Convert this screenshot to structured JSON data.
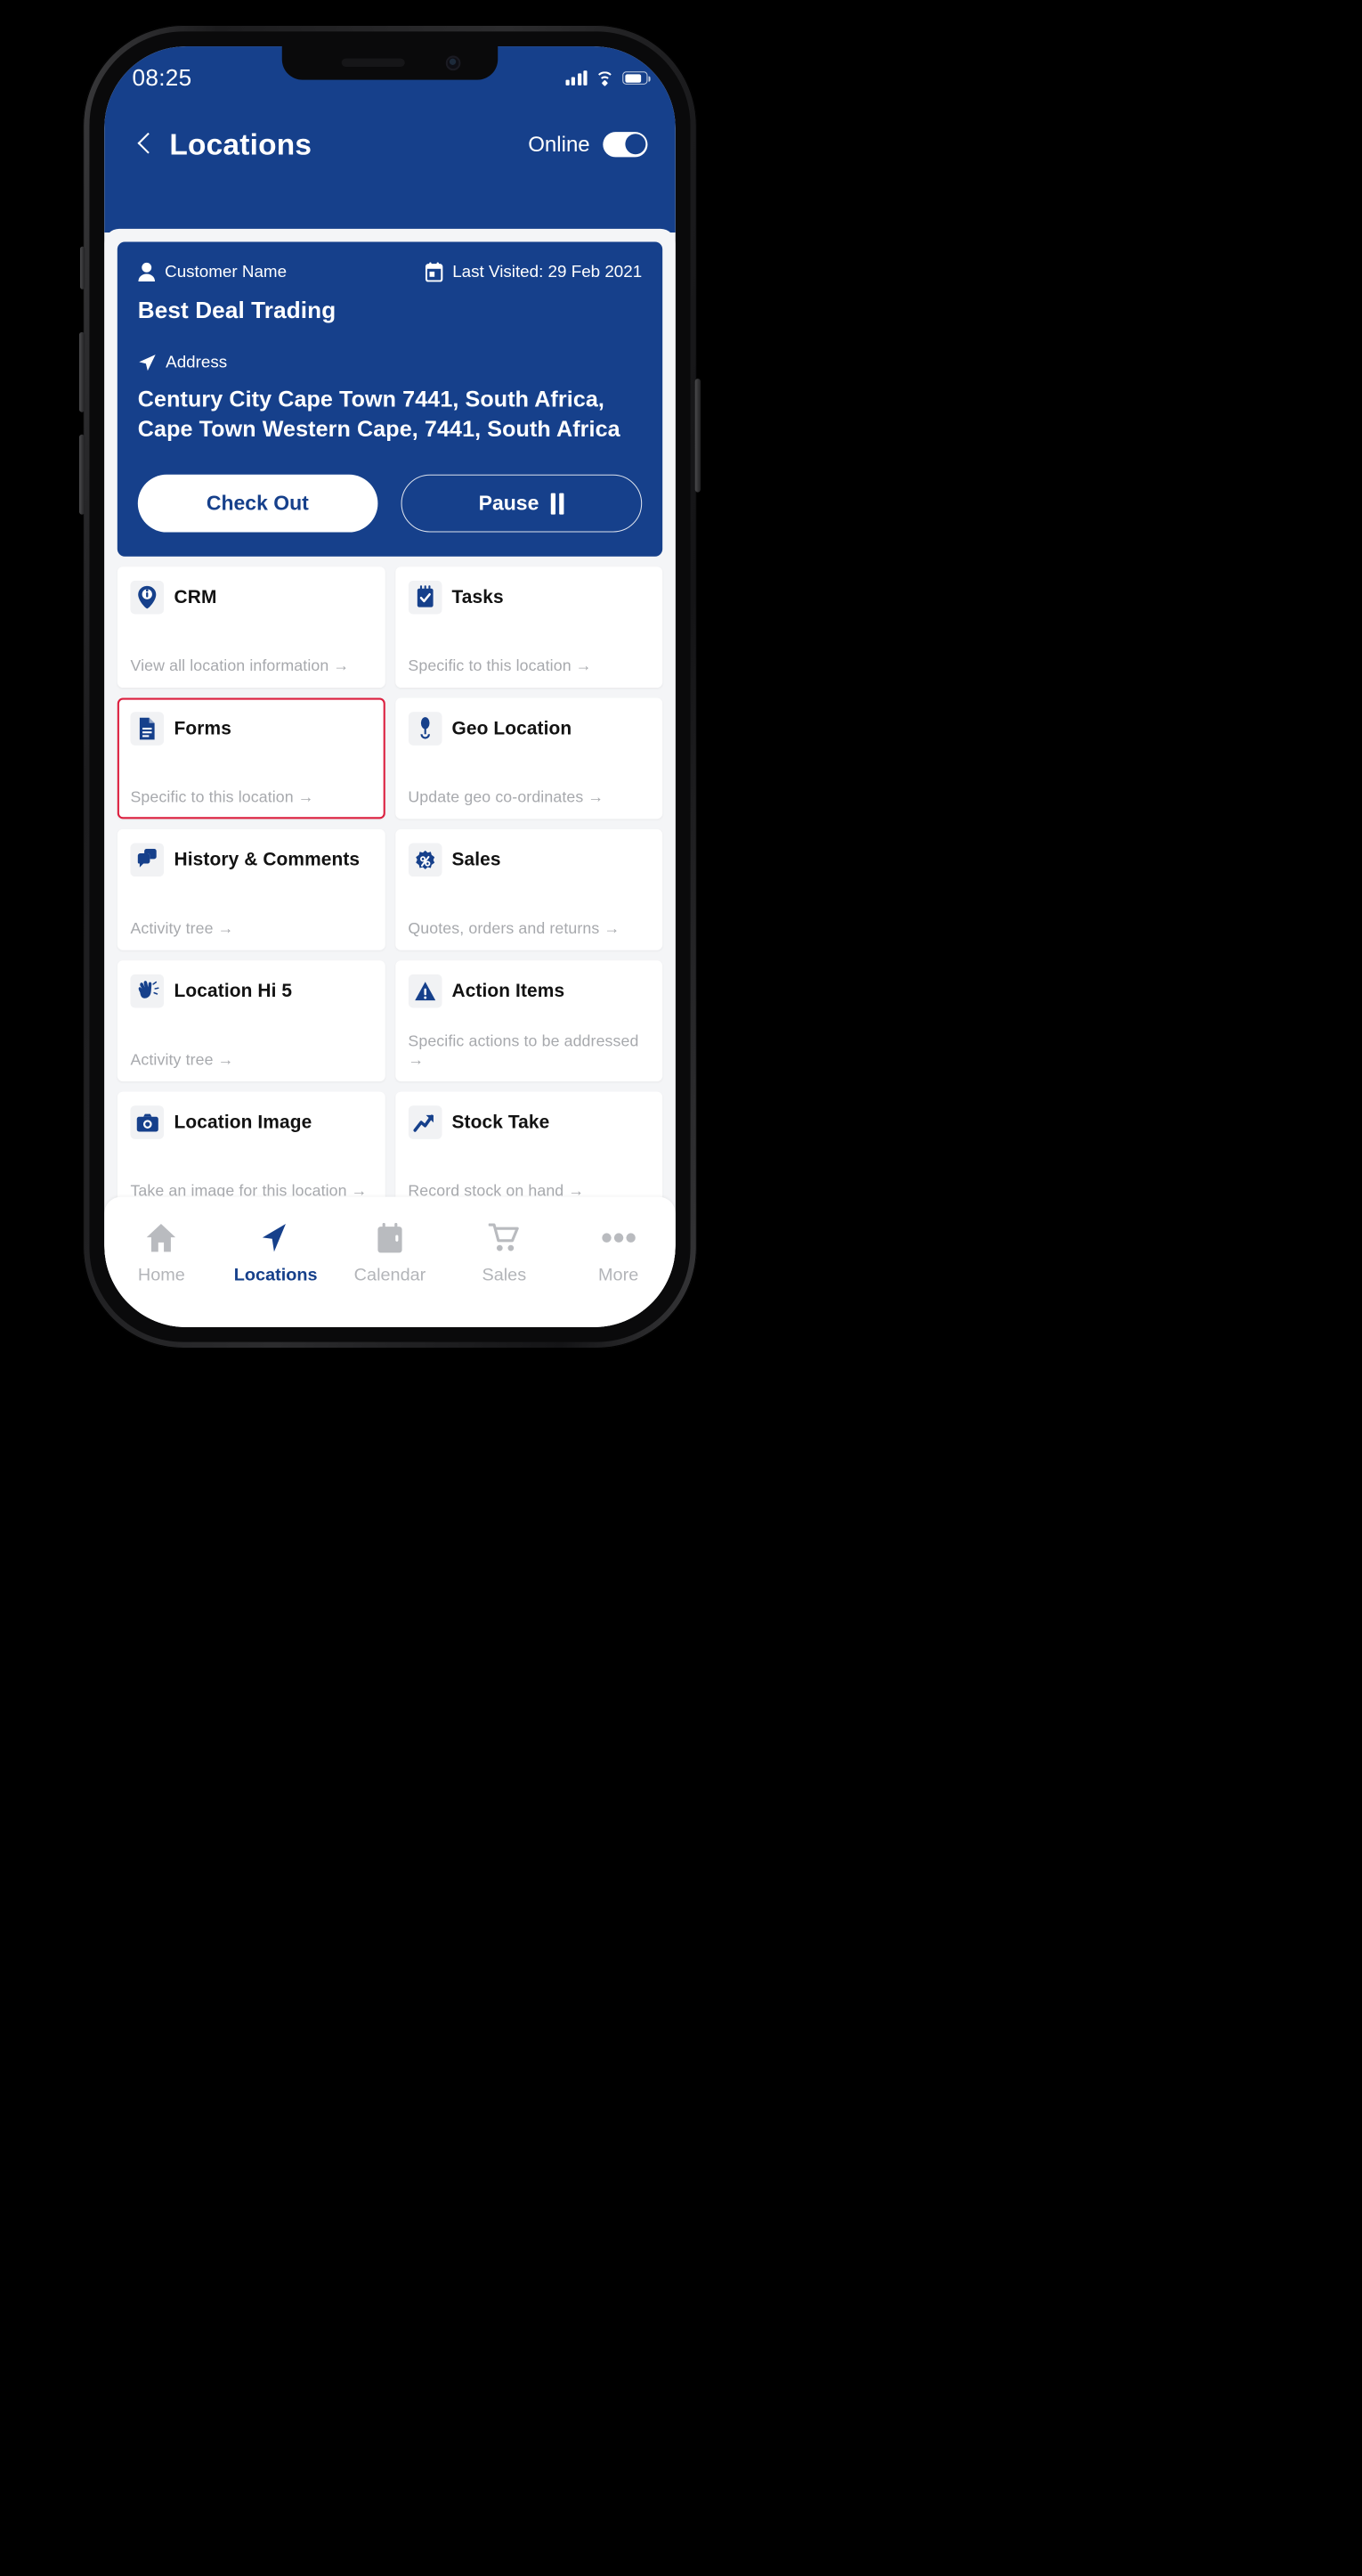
{
  "status_bar": {
    "time": "08:25",
    "icons": [
      "signal-icon",
      "wifi-icon",
      "battery-icon"
    ]
  },
  "nav_header": {
    "back_icon": "chevron-left-icon",
    "title": "Locations",
    "online_label": "Online",
    "toggle_state": "on"
  },
  "customer_card": {
    "customer_label": "Customer Name",
    "customer_icon": "person-icon",
    "last_visited_icon": "calendar-icon",
    "last_visited": "Last Visited: 29 Feb 2021",
    "customer_name": "Best Deal Trading",
    "address_label": "Address",
    "address_icon": "navigation-arrow-icon",
    "address_value": "Century City Cape Town 7441, South Africa, Cape Town Western Cape, 7441, South Africa",
    "checkout_label": "Check Out",
    "pause_label": "Pause",
    "pause_icon": "pause-icon"
  },
  "tiles": [
    {
      "title": "CRM",
      "subtitle": "View all location information →",
      "icon": "map-pin-info-icon",
      "selected": false
    },
    {
      "title": "Tasks",
      "subtitle": "Specific to this location →",
      "icon": "checklist-icon",
      "selected": false
    },
    {
      "title": "Forms",
      "subtitle": "Specific to this location →",
      "icon": "document-icon",
      "selected": true
    },
    {
      "title": "Geo Location",
      "subtitle": "Update geo co-ordinates →",
      "icon": "geo-pin-icon",
      "selected": false
    },
    {
      "title": "History & Comments",
      "subtitle": "Activity tree →",
      "icon": "chat-bubbles-icon",
      "selected": false
    },
    {
      "title": "Sales",
      "subtitle": "Quotes, orders and returns →",
      "icon": "discount-badge-icon",
      "selected": false
    },
    {
      "title": "Location Hi 5",
      "subtitle": "Activity tree →",
      "icon": "hand-wave-icon",
      "selected": false
    },
    {
      "title": "Action Items",
      "subtitle": "Specific actions to be addressed →",
      "icon": "warning-triangle-icon",
      "selected": false
    },
    {
      "title": "Location Image",
      "subtitle": "Take an image for this location →",
      "icon": "camera-icon",
      "selected": false
    },
    {
      "title": "Stock Take",
      "subtitle": "Record stock on hand →",
      "icon": "trend-arrow-icon",
      "selected": false
    }
  ],
  "bottom_nav": [
    {
      "label": "Home",
      "icon": "home-icon",
      "active": false
    },
    {
      "label": "Locations",
      "icon": "navigation-icon",
      "active": true
    },
    {
      "label": "Calendar",
      "icon": "calendar-icon",
      "active": false
    },
    {
      "label": "Sales",
      "icon": "shopping-cart-icon",
      "active": false
    },
    {
      "label": "More",
      "icon": "ellipsis-icon",
      "active": false
    }
  ],
  "colors": {
    "brand_blue": "#16408B",
    "accent_red": "#DC1F3F",
    "surface": "#F4F5F7",
    "muted_text": "#A7A9AD"
  }
}
